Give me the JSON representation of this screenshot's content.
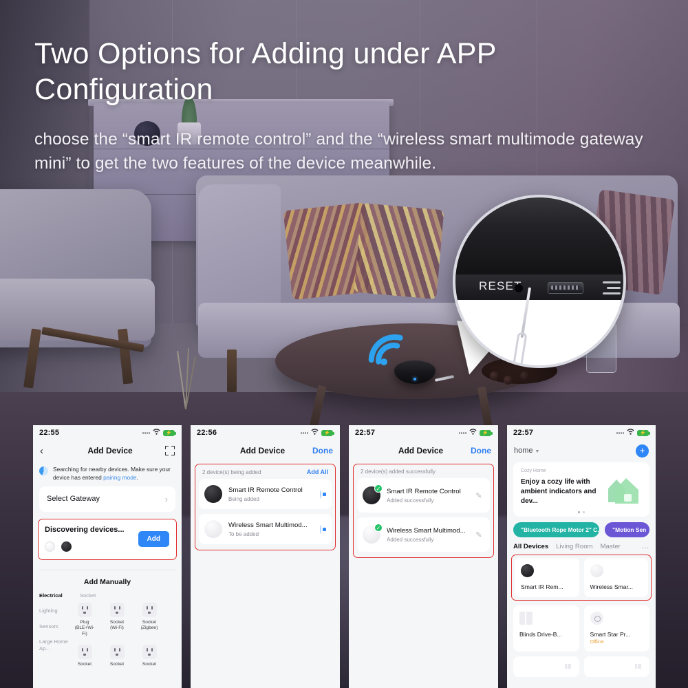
{
  "headline": "Two Options for Adding under APP Configuration",
  "subhead": "choose the “smart IR remote control” and the “wireless smart multimode gateway mini” to get the two features of the device meanwhile.",
  "callout": {
    "reset_label": "RESET"
  },
  "phones": [
    {
      "status": {
        "time": "22:55",
        "location_icon": "location-arrow-icon",
        "wifi_icon": "wifi-icon",
        "battery_icon": "battery-charging-icon"
      },
      "nav": {
        "back_icon": "chevron-left-icon",
        "title": "Add Device",
        "right_icon": "scan-qr-icon"
      },
      "searching": {
        "text_1": "Searching for nearby devices. Make sure your device has entered ",
        "link": "pairing mode",
        "text_2": "."
      },
      "gateway_card": {
        "label": "Select Gateway",
        "chevron": "chevron-right-icon"
      },
      "discovering": {
        "title": "Discovering devices...",
        "add_button": "Add"
      },
      "manual": {
        "title": "Add Manually",
        "categories": [
          "Electrical",
          "Lighting",
          "Sensors",
          "Large Home Ap..."
        ],
        "group_header": "Socket",
        "row1": [
          {
            "name": "Plug",
            "spec": "(BLE+Wi-Fi)"
          },
          {
            "name": "Socket",
            "spec": "(Wi-Fi)"
          },
          {
            "name": "Socket",
            "spec": "(Zigbee)"
          }
        ],
        "row2": [
          {
            "name": "Socket",
            "spec": ""
          },
          {
            "name": "Socket",
            "spec": ""
          },
          {
            "name": "Socket",
            "spec": ""
          }
        ]
      }
    },
    {
      "status": {
        "time": "22:56"
      },
      "nav": {
        "title": "Add Device",
        "done": "Done"
      },
      "panel": {
        "header": "2 device(s) being added",
        "add_all": "Add All"
      },
      "devices": [
        {
          "name": "Smart IR Remote Control",
          "status": "Being added",
          "thumb": "black-puck-icon",
          "action": "stop-square-icon"
        },
        {
          "name": "Wireless Smart Multimod...",
          "status": "To be added",
          "thumb": "white-puck-icon",
          "action": "stop-square-icon"
        }
      ]
    },
    {
      "status": {
        "time": "22:57"
      },
      "nav": {
        "title": "Add Device",
        "done": "Done"
      },
      "panel": {
        "header": "2 device(s) added successfully"
      },
      "devices": [
        {
          "name": "Smart IR Remote Control",
          "status": "Added successfully",
          "thumb": "black-puck-icon",
          "badge": "check-icon",
          "action": "pencil-icon"
        },
        {
          "name": "Wireless Smart Multimod...",
          "status": "Added successfully",
          "thumb": "white-puck-icon",
          "badge": "check-icon",
          "action": "pencil-icon"
        }
      ]
    },
    {
      "status": {
        "time": "22:57"
      },
      "home": {
        "name": "home",
        "caret": "chevron-down-icon",
        "add_icon": "plus-icon"
      },
      "banner": {
        "kicker": "Cozy Home",
        "text": "Enjoy a cozy life with ambient indicators and dev..."
      },
      "pills": [
        {
          "label": "\"Bluetooth Rope Motor 2\" C...",
          "color": "#23b3a4"
        },
        {
          "label": "\"Motion Sen",
          "color": "#6b56d6"
        }
      ],
      "tabs": [
        "All Devices",
        "Living Room",
        "Master",
        "..."
      ],
      "devices_highlight": [
        {
          "name": "Smart IR Rem...",
          "icon": "black-puck-icon"
        },
        {
          "name": "Wireless Smar...",
          "icon": "white-puck-icon"
        }
      ],
      "devices_more": [
        {
          "name": "Blinds Drive-B...",
          "icon": "blinds-icon",
          "status": ""
        },
        {
          "name": "Smart Star Pr...",
          "icon": "star-projector-icon",
          "status": "Offline"
        }
      ]
    }
  ],
  "colors": {
    "accent_blue": "#2f86f6",
    "highlight_red": "#e03131",
    "success_green": "#23c268",
    "offline_orange": "#e8a33d"
  }
}
